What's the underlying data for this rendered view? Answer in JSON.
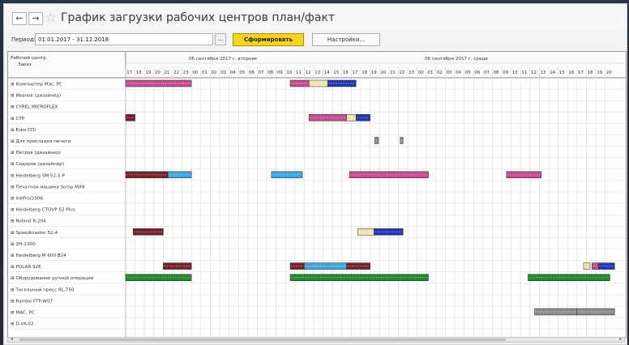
{
  "window": {
    "title": "График загрузки рабочих центров план/факт",
    "back_label": "←",
    "forward_label": "→"
  },
  "filter": {
    "period_label": "Период:",
    "period_value": "01.01.2017 - 31.12.2018",
    "picker_label": "...",
    "form_button_label": "Сформировать",
    "settings_button_label": "Настройки..."
  },
  "table": {
    "header_line1": "Рабочий центр",
    "header_line2": "Заказ",
    "day1_label": "05 сентября 2017 г. вторник",
    "day2_label": "06 сентября 2017 г. среда",
    "hours": [
      "17",
      "18",
      "19",
      "20",
      "21",
      "22",
      "23",
      "00",
      "01",
      "02",
      "03",
      "04",
      "05",
      "06",
      "07",
      "08",
      "09",
      "10",
      "11",
      "12",
      "13",
      "14",
      "15",
      "16",
      "17",
      "18",
      "19",
      "20",
      "21",
      "22",
      "23",
      "00",
      "01",
      "02",
      "03",
      "04",
      "05",
      "06",
      "07",
      "08",
      "09",
      "10",
      "11",
      "12",
      "13",
      "14",
      "15",
      "16",
      "17",
      "18",
      "19",
      "20"
    ],
    "rows": [
      "Компьютер Mac, PC",
      "Иванов (дизайнер)",
      "CYREL MICROFLEX",
      "CTP",
      "Esko CDI",
      "Для прокладки печати",
      "Петров (дизайнер)",
      "Сидоров (дизайнер)",
      "Heidelberg SM 52-5-P",
      "Печатная машина Sorsp M/HI",
      "InkPro/2006",
      "Heidelberg CTOVP 52 Plus",
      "Roland R-204",
      "Speedmaster 52-4",
      "ZH-1300",
      "Heidelberg M 600 B24",
      "POLAR 92E",
      "Оборудование ручной операции",
      "Тигельный пресс RL-750",
      "Rambo FTP-W07",
      "MAC, PC",
      "D-VK-02"
    ]
  },
  "colors": {
    "plan_pink": "#c54a92",
    "plan_blue": "#2336b8",
    "plan_light_blue": "#3ea6dc",
    "plan_green": "#1e8a2a",
    "plan_maroon": "#7a1f2e",
    "plan_cream": "#efe4ae",
    "plan_gray": "#8b8b8b",
    "highlight_yellow": "#f7d31a"
  }
}
